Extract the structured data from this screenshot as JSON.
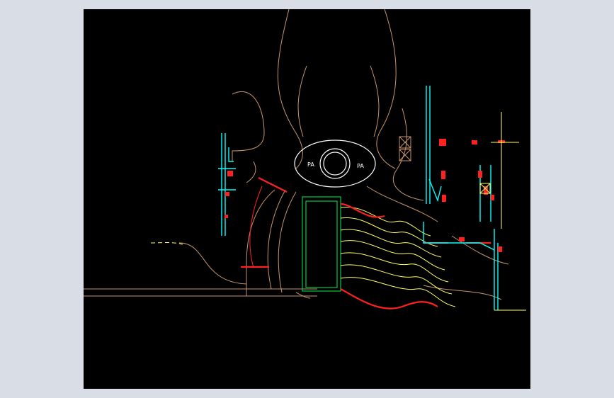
{
  "canvas": {
    "background": "#000000",
    "frame_background": "#d9dee6"
  },
  "labels": {
    "left_oval": "PA",
    "right_oval": "PA"
  },
  "colors": {
    "terrain": "#c8956c",
    "contour": "#ffff66",
    "wall": "#00ffff",
    "accent": "#ff2020",
    "structure": "#00cc44",
    "white": "#ffffff"
  }
}
